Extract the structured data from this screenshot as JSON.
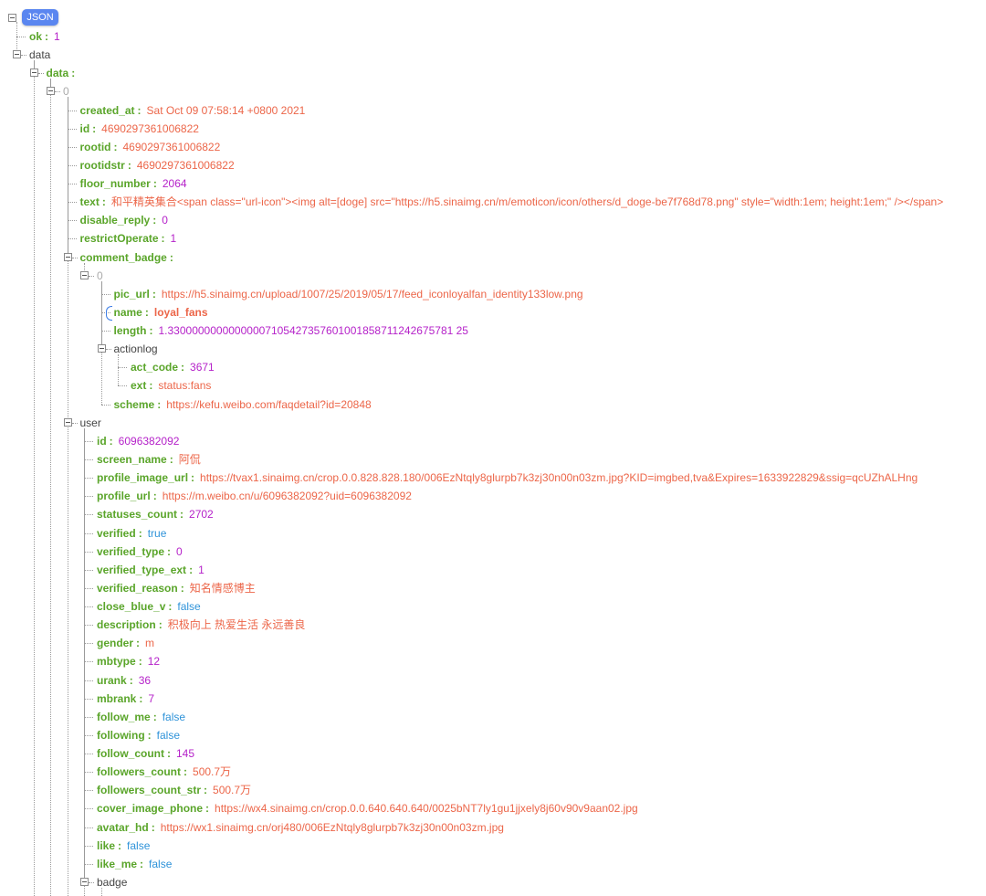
{
  "root_label": "JSON",
  "colors": {
    "key": "#5aa52a",
    "string": "#ec6649",
    "number": "#b522c9",
    "boolean": "#2f93d9",
    "badge": "#5a86f0"
  },
  "icons": {
    "collapse": "minus-box-icon"
  },
  "tree": [
    {
      "level": 1,
      "key": "ok",
      "type": "number",
      "value": "1"
    },
    {
      "level": 1,
      "node": "data"
    },
    {
      "level": 2,
      "key": "data",
      "type": "container"
    },
    {
      "level": 3,
      "node": "0",
      "index": true
    },
    {
      "level": 4,
      "key": "created_at",
      "type": "string",
      "value": "Sat Oct 09 07:58:14 +0800 2021"
    },
    {
      "level": 4,
      "key": "id",
      "type": "string",
      "value": "4690297361006822"
    },
    {
      "level": 4,
      "key": "rootid",
      "type": "string",
      "value": "4690297361006822"
    },
    {
      "level": 4,
      "key": "rootidstr",
      "type": "string",
      "value": "4690297361006822"
    },
    {
      "level": 4,
      "key": "floor_number",
      "type": "number",
      "value": "2064"
    },
    {
      "level": 4,
      "key": "text",
      "type": "string",
      "value": "和平精英集合<span class=\"url-icon\"><img alt=[doge] src=\"https://h5.sinaimg.cn/m/emoticon/icon/others/d_doge-be7f768d78.png\" style=\"width:1em; height:1em;\" /></span>"
    },
    {
      "level": 4,
      "key": "disable_reply",
      "type": "number",
      "value": "0"
    },
    {
      "level": 4,
      "key": "restrictOperate",
      "type": "number",
      "value": "1"
    },
    {
      "level": 4,
      "key": "comment_badge",
      "type": "container"
    },
    {
      "level": 5,
      "node": "0",
      "index": true
    },
    {
      "level": 6,
      "key": "pic_url",
      "type": "string",
      "value": "https://h5.sinaimg.cn/upload/1007/25/2019/05/17/feed_iconloyalfan_identity133low.png"
    },
    {
      "level": 6,
      "key": "name",
      "type": "string",
      "value": "loyal_fans",
      "highlight": true
    },
    {
      "level": 6,
      "key": "length",
      "type": "number",
      "value": "1.33000000000000007105427357601001858711242675781 25"
    },
    {
      "level": 6,
      "node": "actionlog"
    },
    {
      "level": 7,
      "key": "act_code",
      "type": "number",
      "value": "3671"
    },
    {
      "level": 7,
      "key": "ext",
      "type": "string",
      "value": "status:fans"
    },
    {
      "level": 6,
      "key": "scheme",
      "type": "string",
      "value": "https://kefu.weibo.com/faqdetail?id=20848"
    },
    {
      "level": 4,
      "node": "user"
    },
    {
      "level": 5,
      "key": "id",
      "type": "number",
      "value": "6096382092"
    },
    {
      "level": 5,
      "key": "screen_name",
      "type": "string",
      "value": "阿侃"
    },
    {
      "level": 5,
      "key": "profile_image_url",
      "type": "string",
      "value": "https://tvax1.sinaimg.cn/crop.0.0.828.828.180/006EzNtqly8glurpb7k3zj30n00n03zm.jpg?KID=imgbed,tva&Expires=1633922829&ssig=qcUZhALHng"
    },
    {
      "level": 5,
      "key": "profile_url",
      "type": "string",
      "value": "https://m.weibo.cn/u/6096382092?uid=6096382092"
    },
    {
      "level": 5,
      "key": "statuses_count",
      "type": "number",
      "value": "2702"
    },
    {
      "level": 5,
      "key": "verified",
      "type": "boolean",
      "value": "true"
    },
    {
      "level": 5,
      "key": "verified_type",
      "type": "number",
      "value": "0"
    },
    {
      "level": 5,
      "key": "verified_type_ext",
      "type": "number",
      "value": "1"
    },
    {
      "level": 5,
      "key": "verified_reason",
      "type": "string",
      "value": "知名情感博主"
    },
    {
      "level": 5,
      "key": "close_blue_v",
      "type": "boolean",
      "value": "false"
    },
    {
      "level": 5,
      "key": "description",
      "type": "string",
      "value": "积极向上 热爱生活 永远善良"
    },
    {
      "level": 5,
      "key": "gender",
      "type": "string",
      "value": "m"
    },
    {
      "level": 5,
      "key": "mbtype",
      "type": "number",
      "value": "12"
    },
    {
      "level": 5,
      "key": "urank",
      "type": "number",
      "value": "36"
    },
    {
      "level": 5,
      "key": "mbrank",
      "type": "number",
      "value": "7"
    },
    {
      "level": 5,
      "key": "follow_me",
      "type": "boolean",
      "value": "false"
    },
    {
      "level": 5,
      "key": "following",
      "type": "boolean",
      "value": "false"
    },
    {
      "level": 5,
      "key": "follow_count",
      "type": "number",
      "value": "145"
    },
    {
      "level": 5,
      "key": "followers_count",
      "type": "string",
      "value": "500.7万"
    },
    {
      "level": 5,
      "key": "followers_count_str",
      "type": "string",
      "value": "500.7万"
    },
    {
      "level": 5,
      "key": "cover_image_phone",
      "type": "string",
      "value": "https://wx4.sinaimg.cn/crop.0.0.640.640.640/0025bNT7ly1gu1jjxely8j60v90v9aan02.jpg"
    },
    {
      "level": 5,
      "key": "avatar_hd",
      "type": "string",
      "value": "https://wx1.sinaimg.cn/orj480/006EzNtqly8glurpb7k3zj30n00n03zm.jpg"
    },
    {
      "level": 5,
      "key": "like",
      "type": "boolean",
      "value": "false"
    },
    {
      "level": 5,
      "key": "like_me",
      "type": "boolean",
      "value": "false"
    },
    {
      "level": 5,
      "node": "badge"
    }
  ]
}
